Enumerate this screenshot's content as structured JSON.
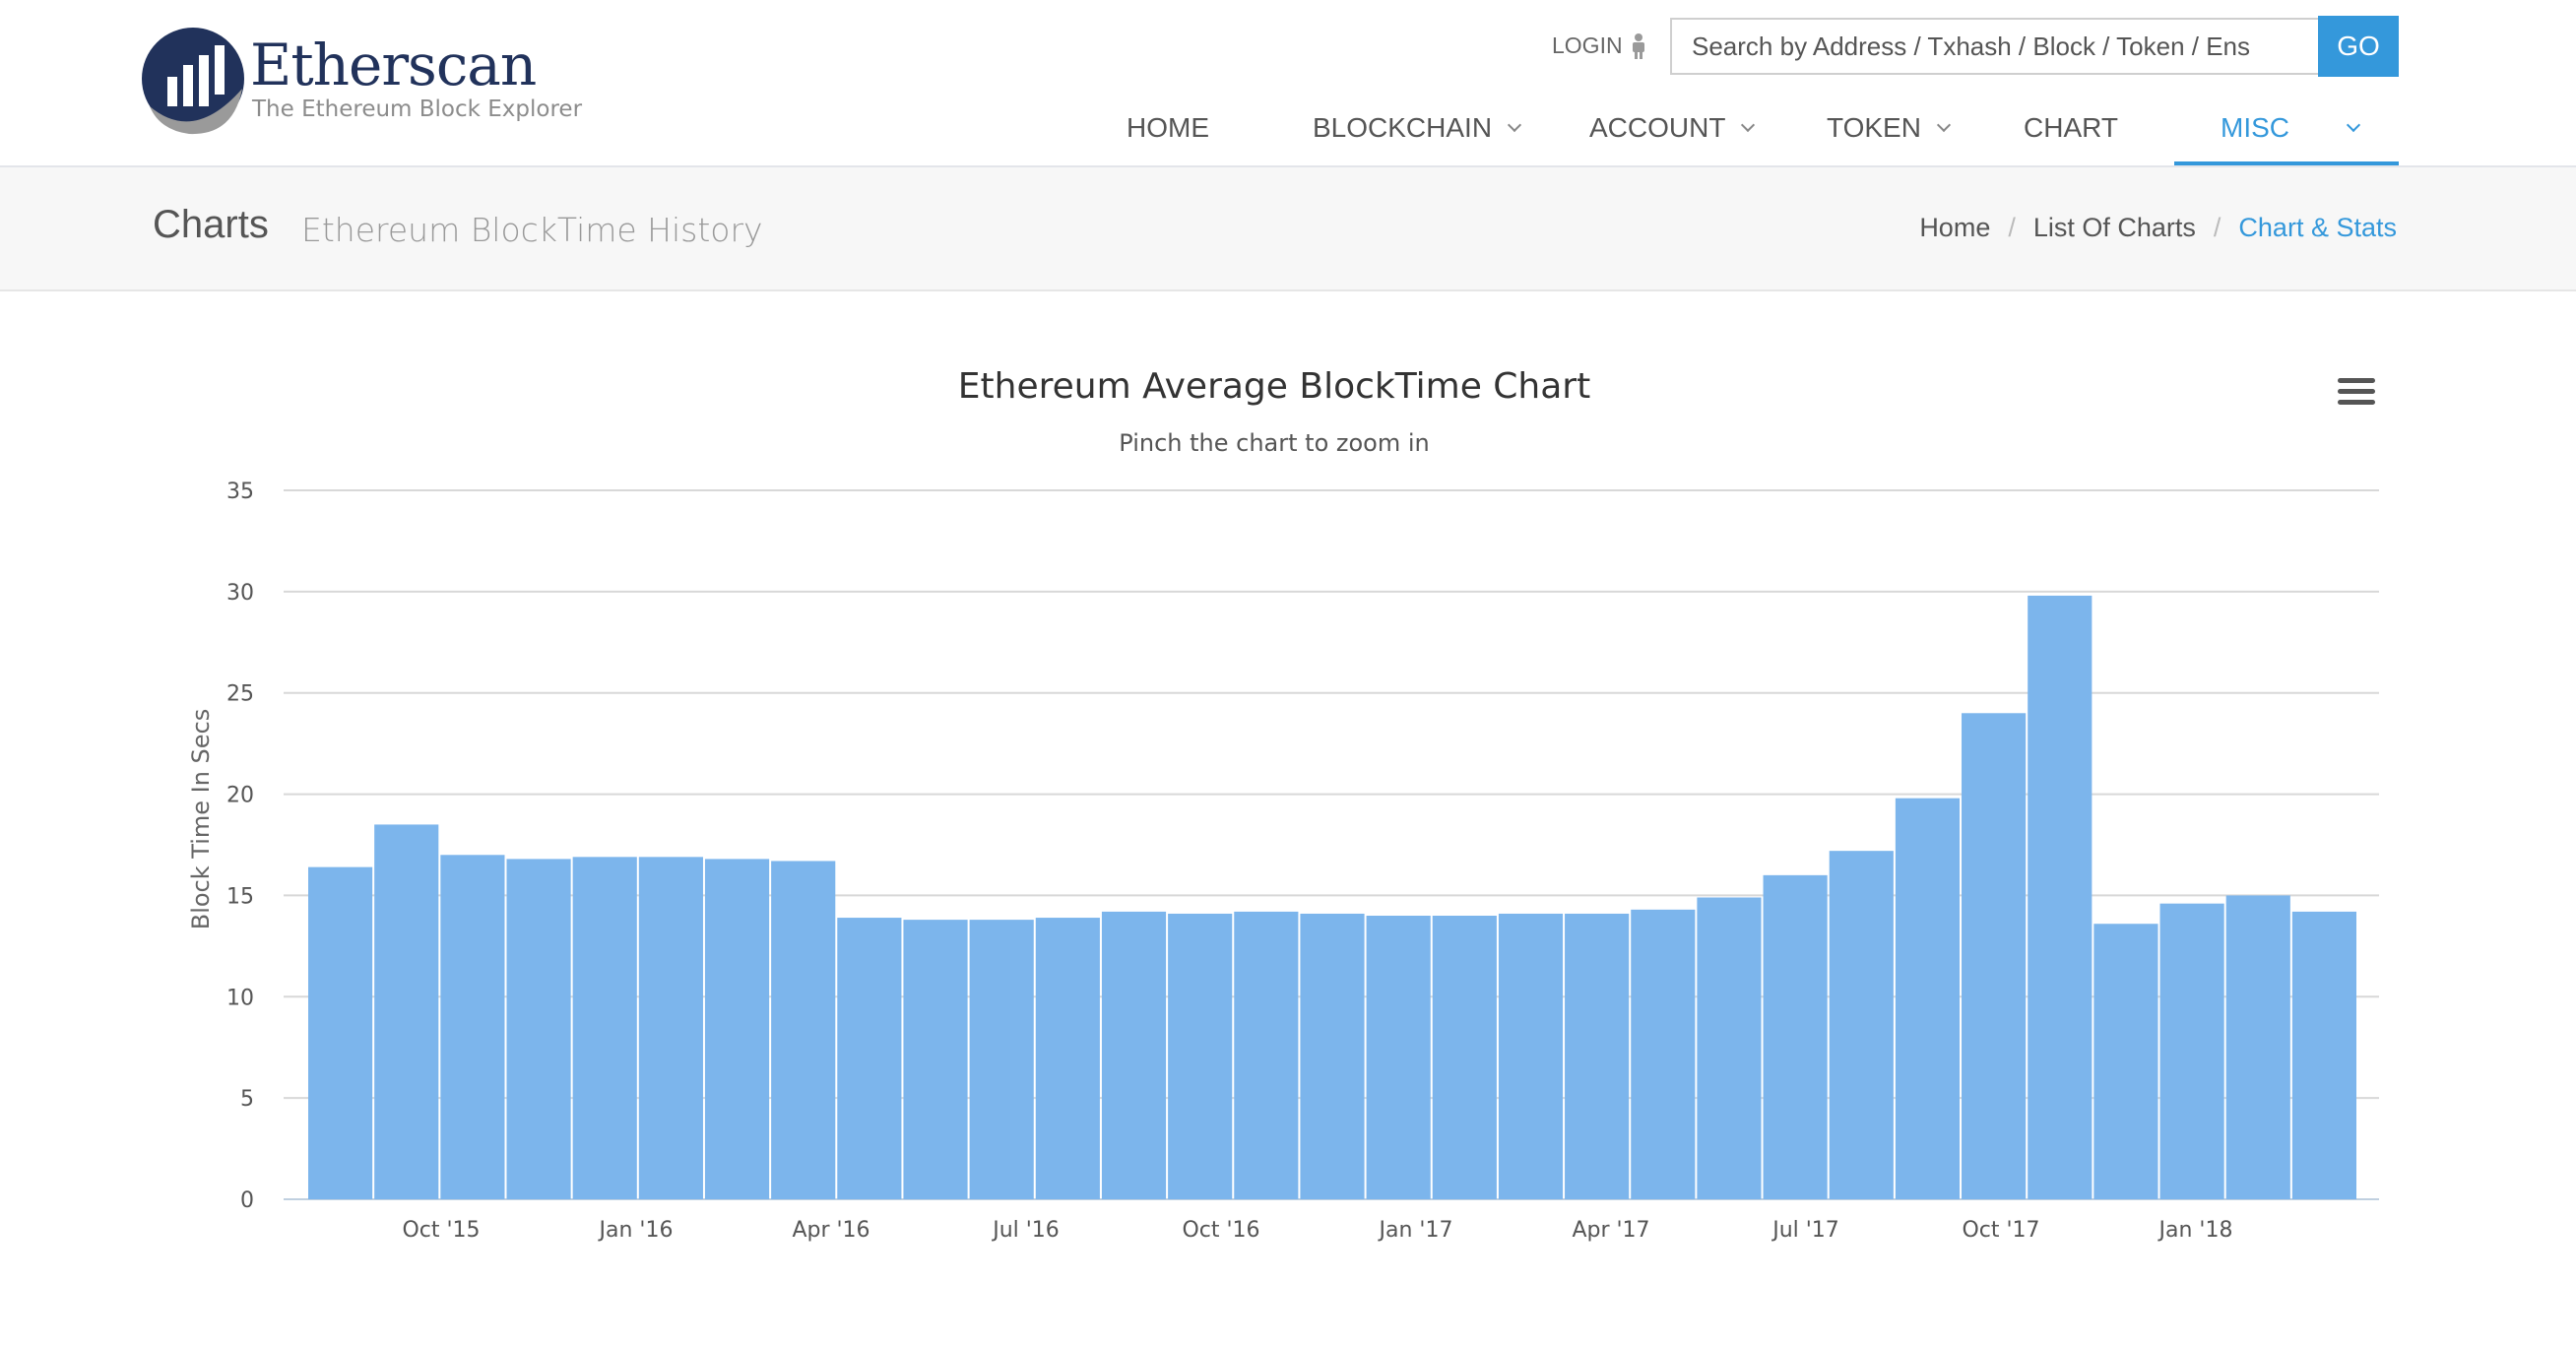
{
  "brand": {
    "name": "Etherscan",
    "tagline": "The Ethereum Block Explorer"
  },
  "header": {
    "login_label": "LOGIN",
    "search": {
      "placeholder": "Search by Address / Txhash / Block / Token / Ens",
      "value": ""
    },
    "go_label": "GO",
    "nav": [
      {
        "label": "HOME",
        "dropdown": false
      },
      {
        "label": "BLOCKCHAIN",
        "dropdown": true
      },
      {
        "label": "ACCOUNT",
        "dropdown": true
      },
      {
        "label": "TOKEN",
        "dropdown": true
      },
      {
        "label": "CHART",
        "dropdown": false
      },
      {
        "label": "MISC",
        "dropdown": true,
        "active": true
      }
    ]
  },
  "subheader": {
    "title": "Charts",
    "subtitle": "Ethereum BlockTime History",
    "breadcrumb": [
      "Home",
      "List Of Charts",
      "Chart & Stats"
    ]
  },
  "colors": {
    "accent": "#3498db",
    "bar": "#7cb5ec"
  },
  "chart_data": {
    "type": "bar",
    "title": "Ethereum Average BlockTime Chart",
    "subtitle": "Pinch the chart to zoom in",
    "ylabel": "Block Time In Secs",
    "xlabel": "",
    "ylim": [
      0,
      35
    ],
    "yticks": [
      0,
      5,
      10,
      15,
      20,
      25,
      30,
      35
    ],
    "xticks": [
      "Oct '15",
      "Jan '16",
      "Apr '16",
      "Jul '16",
      "Oct '16",
      "Jan '17",
      "Apr '17",
      "Jul '17",
      "Oct '17",
      "Jan '18"
    ],
    "grid": true,
    "categories": [
      "Aug '15",
      "Sep '15",
      "Oct '15",
      "Nov '15",
      "Dec '15",
      "Jan '16",
      "Feb '16",
      "Mar '16",
      "Apr '16",
      "May '16",
      "Jun '16",
      "Jul '16",
      "Aug '16",
      "Sep '16",
      "Oct '16",
      "Nov '16",
      "Dec '16",
      "Jan '17",
      "Feb '17",
      "Mar '17",
      "Apr '17",
      "May '17",
      "Jun '17",
      "Jul '17",
      "Aug '17",
      "Sep '17",
      "Oct '17",
      "Nov '17",
      "Dec '17",
      "Jan '18",
      "Feb '18"
    ],
    "values": [
      16.4,
      18.5,
      17.0,
      16.8,
      16.9,
      16.9,
      16.8,
      16.7,
      13.9,
      13.8,
      13.8,
      13.9,
      14.2,
      14.1,
      14.2,
      14.1,
      14.0,
      14.0,
      14.1,
      14.1,
      14.3,
      14.9,
      16.0,
      17.2,
      19.8,
      24.0,
      29.8,
      13.6,
      14.6,
      15.0,
      14.2
    ]
  }
}
